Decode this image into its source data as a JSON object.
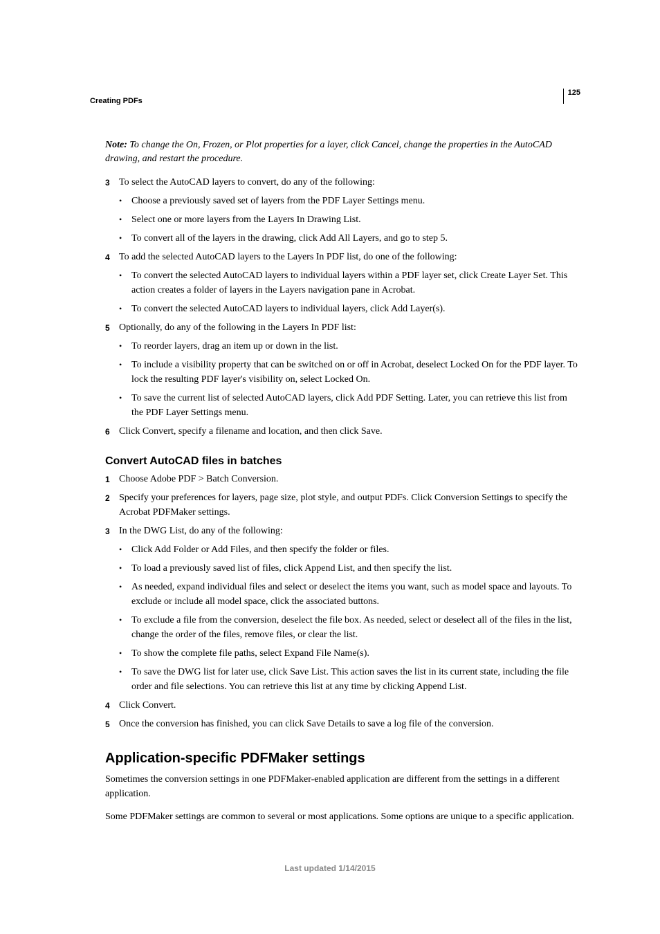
{
  "pageNumber": "125",
  "headerSection": "Creating PDFs",
  "note": {
    "label": "Note: ",
    "text": "To change the On, Frozen, or Plot properties for a layer, click Cancel, change the properties in the AutoCAD drawing, and restart the procedure."
  },
  "steps1": [
    {
      "num": "3",
      "text": "To select the AutoCAD layers to convert, do any of the following:",
      "sub": [
        "Choose a previously saved set of layers from the PDF Layer Settings menu.",
        "Select one or more layers from the Layers In Drawing List.",
        "To convert all of the layers in the drawing, click Add All Layers, and go to step 5."
      ]
    },
    {
      "num": "4",
      "text": "To add the selected AutoCAD layers to the Layers In PDF list, do one of the following:",
      "sub": [
        "To convert the selected AutoCAD layers to individual layers within a PDF layer set, click Create Layer Set. This action creates a folder of layers in the Layers navigation pane in Acrobat.",
        "To convert the selected AutoCAD layers to individual layers, click Add Layer(s)."
      ]
    },
    {
      "num": "5",
      "text": "Optionally, do any of the following in the Layers In PDF list:",
      "sub": [
        "To reorder layers, drag an item up or down in the list.",
        "To include a visibility property that can be switched on or off in Acrobat, deselect Locked On for the PDF layer. To lock the resulting PDF layer's visibility on, select Locked On.",
        "To save the current list of selected AutoCAD layers, click Add PDF Setting. Later, you can retrieve this list from the PDF Layer Settings menu."
      ]
    },
    {
      "num": "6",
      "text": "Click Convert, specify a filename and location, and then click Save."
    }
  ],
  "h2": "Convert AutoCAD files in batches",
  "steps2": [
    {
      "num": "1",
      "text": "Choose Adobe PDF > Batch Conversion."
    },
    {
      "num": "2",
      "text": "Specify your preferences for layers, page size, plot style, and output PDFs. Click Conversion Settings to specify the Acrobat PDFMaker settings."
    },
    {
      "num": "3",
      "text": "In the DWG List, do any of the following:",
      "sub": [
        "Click Add Folder or Add Files, and then specify the folder or files.",
        "To load a previously saved list of files, click Append List, and then specify the list.",
        "As needed, expand individual files and select or deselect the items you want, such as model space and layouts. To exclude or include all model space, click the associated buttons.",
        "To exclude a file from the conversion, deselect the file box. As needed, select or deselect all of the files in the list, change the order of the files, remove files, or clear the list.",
        "To show the complete file paths, select Expand File Name(s).",
        "To save the DWG list for later use, click Save List. This action saves the list in its current state, including the file order and file selections. You can retrieve this list at any time by clicking Append List."
      ]
    },
    {
      "num": "4",
      "text": "Click Convert."
    },
    {
      "num": "5",
      "text": "Once the conversion has finished, you can click Save Details to save a log file of the conversion."
    }
  ],
  "h1": "Application-specific PDFMaker settings",
  "para1": "Sometimes the conversion settings in one PDFMaker-enabled application are different from the settings in a different application.",
  "para2": "Some PDFMaker settings are common to several or most applications. Some options are unique to a specific application.",
  "footer": "Last updated 1/14/2015"
}
